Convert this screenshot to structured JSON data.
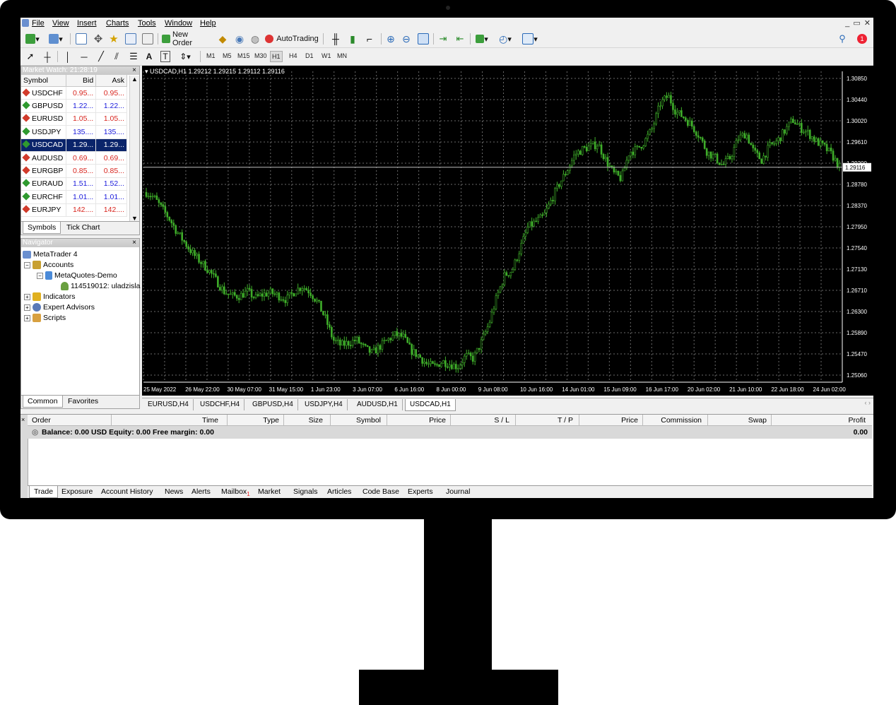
{
  "menu": [
    "File",
    "View",
    "Insert",
    "Charts",
    "Tools",
    "Window",
    "Help"
  ],
  "toolbar": {
    "new_order": "New Order",
    "autotrading": "AutoTrading",
    "timeframes": [
      "M1",
      "M5",
      "M15",
      "M30",
      "H1",
      "H4",
      "D1",
      "W1",
      "MN"
    ],
    "active_timeframe": "H1",
    "notification_count": "1"
  },
  "market_watch": {
    "title": "Market Watch: 21:28:19",
    "columns": [
      "Symbol",
      "Bid",
      "Ask"
    ],
    "rows": [
      {
        "symbol": "USDCHF",
        "bid": "0.95...",
        "ask": "0.95...",
        "dir": "down"
      },
      {
        "symbol": "GBPUSD",
        "bid": "1.22...",
        "ask": "1.22...",
        "dir": "up"
      },
      {
        "symbol": "EURUSD",
        "bid": "1.05...",
        "ask": "1.05...",
        "dir": "down"
      },
      {
        "symbol": "USDJPY",
        "bid": "135....",
        "ask": "135....",
        "dir": "up"
      },
      {
        "symbol": "USDCAD",
        "bid": "1.29...",
        "ask": "1.29...",
        "dir": "up",
        "selected": true
      },
      {
        "symbol": "AUDUSD",
        "bid": "0.69...",
        "ask": "0.69...",
        "dir": "down"
      },
      {
        "symbol": "EURGBP",
        "bid": "0.85...",
        "ask": "0.85...",
        "dir": "down"
      },
      {
        "symbol": "EURAUD",
        "bid": "1.51...",
        "ask": "1.52...",
        "dir": "up"
      },
      {
        "symbol": "EURCHF",
        "bid": "1.01...",
        "ask": "1.01...",
        "dir": "up"
      },
      {
        "symbol": "EURJPY",
        "bid": "142....",
        "ask": "142....",
        "dir": "down"
      }
    ],
    "tabs": [
      "Symbols",
      "Tick Chart"
    ]
  },
  "navigator": {
    "title": "Navigator",
    "root": "MetaTrader 4",
    "accounts": "Accounts",
    "server": "MetaQuotes-Demo",
    "account": "114519012: uladzisla",
    "indicators": "Indicators",
    "experts": "Expert Advisors",
    "scripts": "Scripts",
    "tabs": [
      "Common",
      "Favorites"
    ]
  },
  "chart": {
    "header": "USDCAD,H1  1.29212 1.29215 1.29112 1.29116",
    "current_price": "1.29116",
    "price_labels": [
      "1.30850",
      "1.30440",
      "1.30020",
      "1.29610",
      "1.29200",
      "1.28780",
      "1.28370",
      "1.27950",
      "1.27540",
      "1.27130",
      "1.26710",
      "1.26300",
      "1.25890",
      "1.25470",
      "1.25060"
    ],
    "time_labels": [
      "25 May 2022",
      "26 May 22:00",
      "30 May 07:00",
      "31 May 15:00",
      "1 Jun 23:00",
      "3 Jun 07:00",
      "6 Jun 16:00",
      "8 Jun 00:00",
      "9 Jun 08:00",
      "10 Jun 16:00",
      "14 Jun 01:00",
      "15 Jun 09:00",
      "16 Jun 17:00",
      "20 Jun 02:00",
      "21 Jun 10:00",
      "22 Jun 18:00",
      "24 Jun 02:00"
    ],
    "ylim": [
      1.2506,
      1.3085
    ],
    "close_path": [
      1.2865,
      1.2855,
      1.2835,
      1.2815,
      1.279,
      1.277,
      1.275,
      1.2735,
      1.272,
      1.27,
      1.268,
      1.2672,
      1.2672,
      1.268,
      1.2668,
      1.2675,
      1.2678,
      1.2672,
      1.2665,
      1.268,
      1.269,
      1.268,
      1.266,
      1.263,
      1.259,
      1.258,
      1.2585,
      1.259,
      1.2575,
      1.2565,
      1.2578,
      1.259,
      1.26,
      1.2595,
      1.257,
      1.256,
      1.2545,
      1.254,
      1.255,
      1.2545,
      1.254,
      1.256,
      1.2555,
      1.2585,
      1.262,
      1.267,
      1.271,
      1.272,
      1.276,
      1.28,
      1.281,
      1.282,
      1.285,
      1.288,
      1.2905,
      1.2935,
      1.2945,
      1.295,
      1.2955,
      1.2925,
      1.29,
      1.289,
      1.294,
      1.2945,
      1.296,
      1.2985,
      1.303,
      1.3045,
      1.3015,
      1.3005,
      1.299,
      1.297,
      1.294,
      1.293,
      1.2915,
      1.293,
      1.2965,
      1.2975,
      1.294,
      1.2925,
      1.295,
      1.296,
      1.298,
      1.3,
      1.2985,
      1.2975,
      1.296,
      1.295,
      1.2935,
      1.2912
    ],
    "tabs": [
      "EURUSD,H4",
      "USDCHF,H4",
      "GBPUSD,H4",
      "USDJPY,H4",
      "AUDUSD,H1",
      "USDCAD,H1"
    ],
    "active_tab": "USDCAD,H1"
  },
  "terminal": {
    "columns": [
      "Order",
      "Time",
      "Type",
      "Size",
      "Symbol",
      "Price",
      "S / L",
      "T / P",
      "Price",
      "Commission",
      "Swap",
      "Profit"
    ],
    "balance_text": "Balance: 0.00 USD  Equity: 0.00  Free margin: 0.00",
    "profit": "0.00",
    "tabs": [
      "Trade",
      "Exposure",
      "Account History",
      "News",
      "Alerts",
      "Mailbox",
      "Market",
      "Signals",
      "Articles",
      "Code Base",
      "Experts",
      "Journal"
    ],
    "mailbox_badge": "1",
    "active_tab": "Trade"
  },
  "colors": {
    "candle": "#3fae2a",
    "selected_row": "#0a246a",
    "chart_bg": "#000000"
  }
}
